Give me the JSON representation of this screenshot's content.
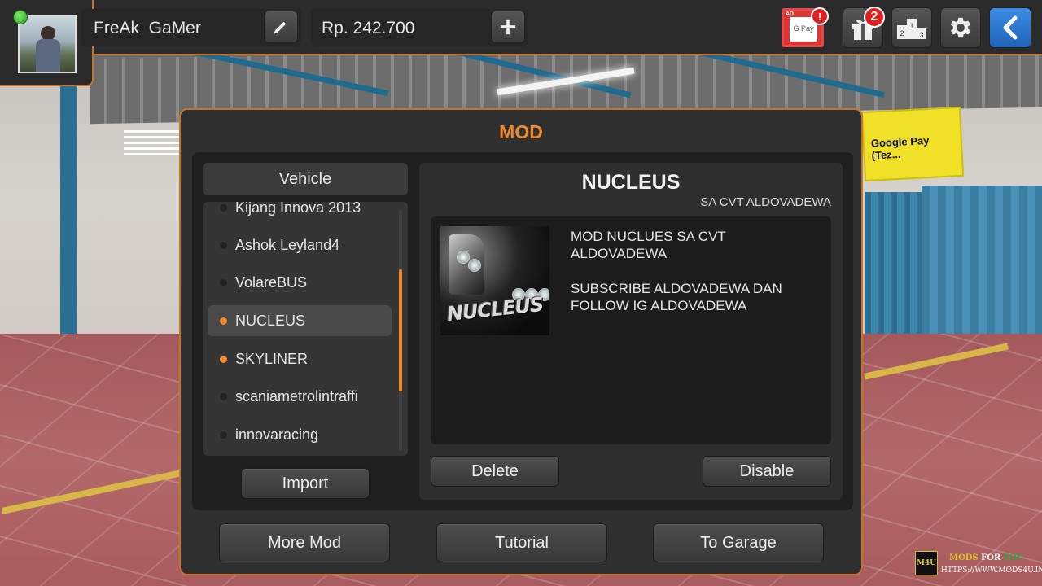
{
  "profile": {
    "name": "FreAk  GaMer",
    "money": "Rp. 242.700",
    "status_color": "#3cc22a"
  },
  "top_icons": {
    "gpay_card_text": "G Pay",
    "gpay_ad_label": "AD",
    "gpay_badge": "!",
    "gift_badge": "2",
    "leaderboard_text": "2 1 3"
  },
  "background_sign": "Google Pay (Tez...",
  "modal": {
    "title": "MOD",
    "list_header": "Vehicle",
    "items": [
      {
        "label": "Kijang Innova 2013",
        "flag": false,
        "active": false
      },
      {
        "label": "Ashok Leyland4",
        "flag": false,
        "active": false
      },
      {
        "label": "VolareBUS",
        "flag": false,
        "active": false
      },
      {
        "label": "NUCLEUS",
        "flag": true,
        "active": true
      },
      {
        "label": "SKYLINER",
        "flag": true,
        "active": false
      },
      {
        "label": "scaniametrolintraffi",
        "flag": false,
        "active": false
      },
      {
        "label": "innovaracing",
        "flag": false,
        "active": false
      }
    ],
    "scroll_position": 0.5,
    "import_label": "Import",
    "detail": {
      "title": "NUCLEUS",
      "subtitle": "SA CVT ALDOVADEWA",
      "thumb_text": "NUCLEUS",
      "description_1": "MOD NUCLUES SA CVT ALDOVADEWA",
      "description_2": "SUBSCRIBE ALDOVADEWA DAN FOLLOW IG ALDOVADEWA",
      "delete_label": "Delete",
      "disable_label": "Disable"
    },
    "footer": {
      "more_mod_label": "More Mod",
      "tutorial_label": "Tutorial",
      "to_garage_label": "To Garage"
    }
  },
  "watermark": {
    "logo": "M4U",
    "mods": "MODS",
    "for": "FOR",
    "you": "YOU",
    "url": "HTTPS://WWW.MODS4U.IN"
  },
  "colors": {
    "accent_orange": "#f08a2a",
    "back_button_blue": "#2a78d4",
    "badge_red": "#e02020"
  }
}
